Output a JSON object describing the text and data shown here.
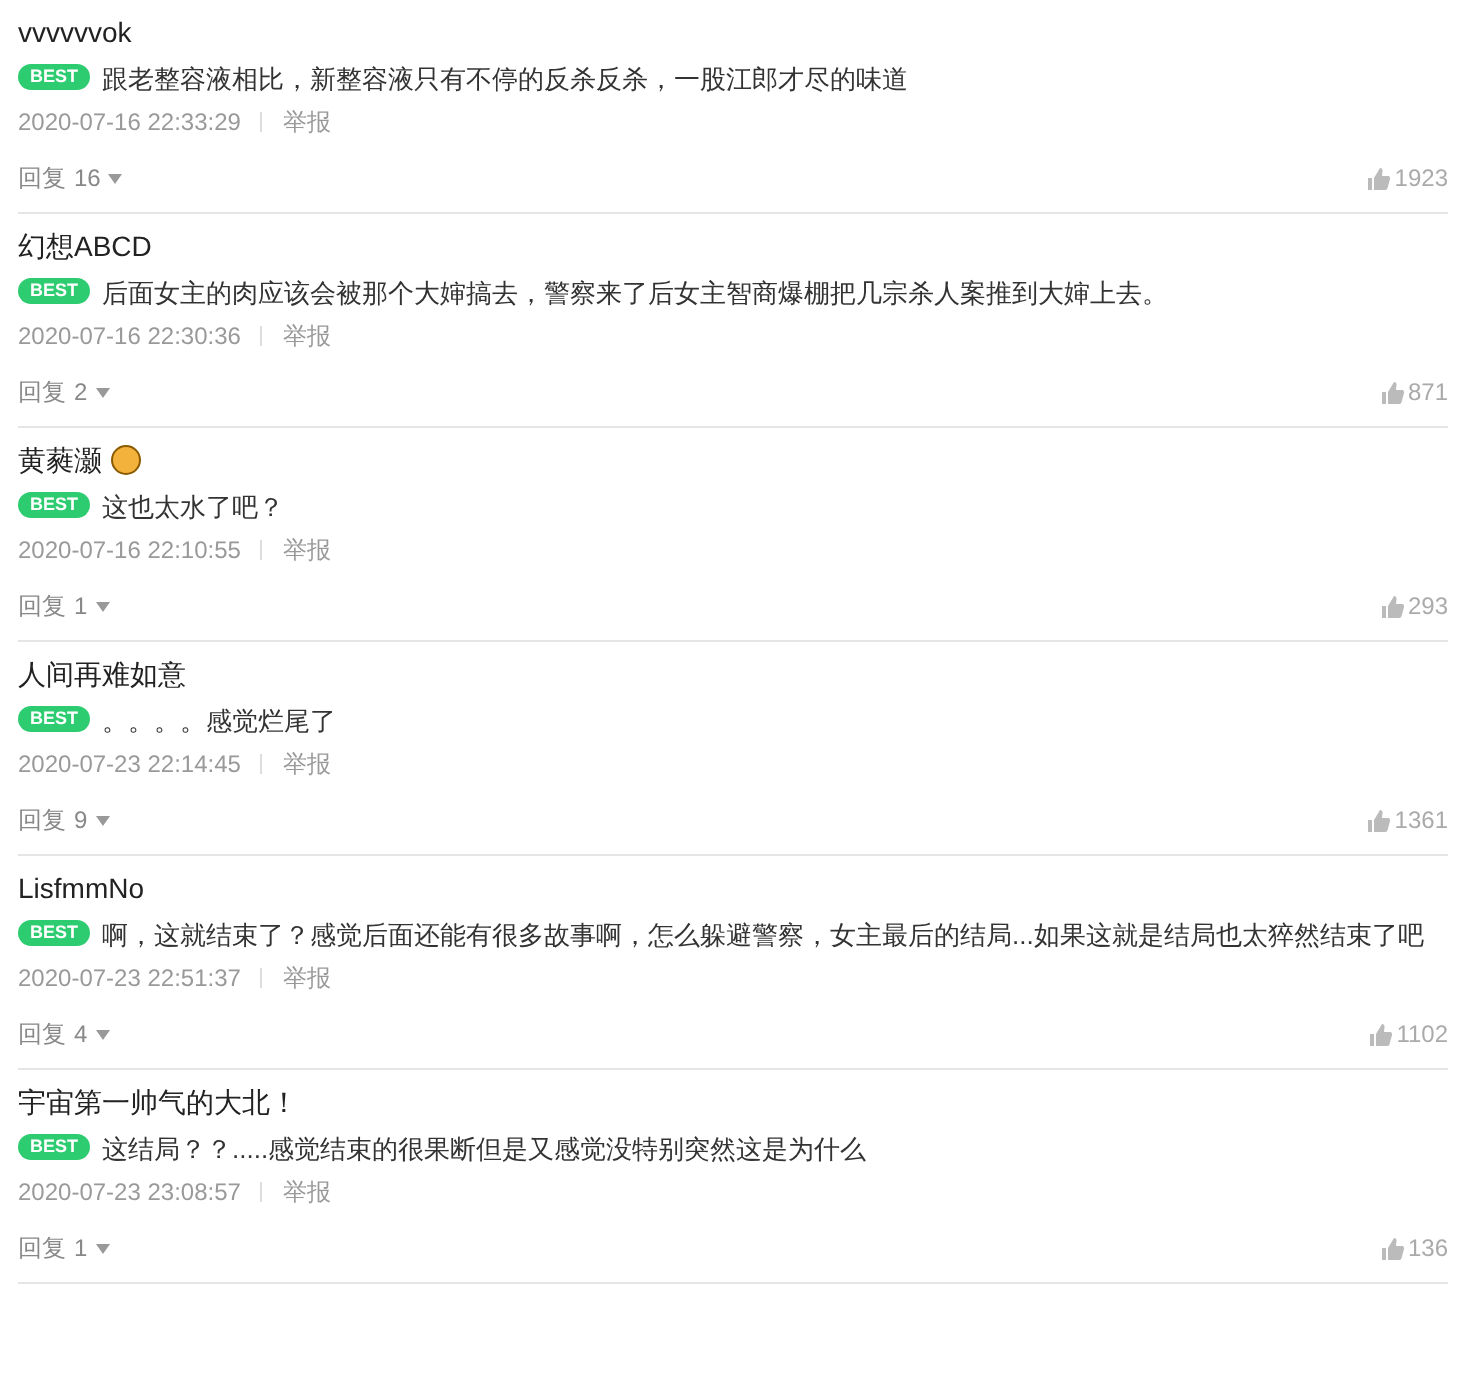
{
  "comments": [
    {
      "user": "vvvvvvok",
      "has_emoji": false,
      "badge": "BEST",
      "text": "跟老整容液相比，新整容液只有不停的反杀反杀，一股江郎才尽的味道",
      "time": "2020-07-16 22:33:29",
      "report": "举报",
      "reply_label": "回复",
      "reply_count": "16",
      "likes": "1923"
    },
    {
      "user": "幻想ABCD",
      "has_emoji": false,
      "badge": "BEST",
      "text": "后面女主的肉应该会被那个大婶搞去，警察来了后女主智商爆棚把几宗杀人案推到大婶上去。",
      "time": "2020-07-16 22:30:36",
      "report": "举报",
      "reply_label": "回复",
      "reply_count": "2",
      "likes": "871"
    },
    {
      "user": "黄蕤灏",
      "has_emoji": true,
      "badge": "BEST",
      "text": "这也太水了吧？",
      "time": "2020-07-16 22:10:55",
      "report": "举报",
      "reply_label": "回复",
      "reply_count": "1",
      "likes": "293"
    },
    {
      "user": "人间再难如意",
      "has_emoji": false,
      "badge": "BEST",
      "text": "。。。。感觉烂尾了",
      "time": "2020-07-23 22:14:45",
      "report": "举报",
      "reply_label": "回复",
      "reply_count": "9",
      "likes": "1361"
    },
    {
      "user": "LisfmmNo",
      "has_emoji": false,
      "badge": "BEST",
      "text": "啊，这就结束了？感觉后面还能有很多故事啊，怎么躲避警察，女主最后的结局...如果这就是结局也太猝然结束了吧",
      "time": "2020-07-23 22:51:37",
      "report": "举报",
      "reply_label": "回复",
      "reply_count": "4",
      "likes": "1102"
    },
    {
      "user": "宇宙第一帅气的大北！",
      "has_emoji": false,
      "badge": "BEST",
      "text": "这结局？？.....感觉结束的很果断但是又感觉没特别突然这是为什么",
      "time": "2020-07-23 23:08:57",
      "report": "举报",
      "reply_label": "回复",
      "reply_count": "1",
      "likes": "136"
    }
  ]
}
